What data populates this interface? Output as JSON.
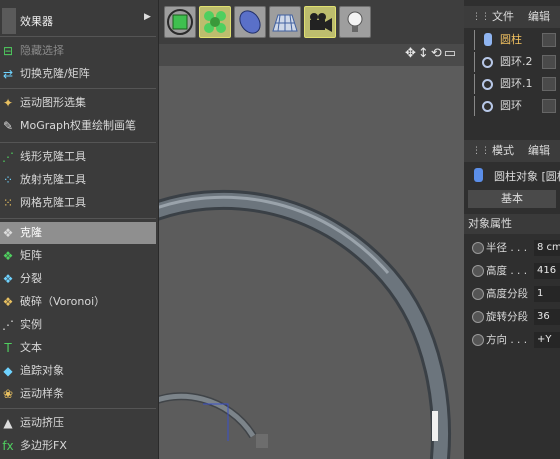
{
  "menu": {
    "title": "效果器",
    "items": [
      {
        "label": "隐藏选择",
        "icon": "⊟",
        "state": "disabled"
      },
      {
        "label": "切换克隆/矩阵",
        "icon": "⇄",
        "state": "normal"
      },
      {
        "label": "运动图形选集",
        "icon": "✦",
        "state": "normal"
      },
      {
        "label": "MoGraph权重绘制画笔",
        "icon": "✎",
        "state": "normal"
      },
      {
        "label": "线形克隆工具",
        "icon": "⋰",
        "state": "normal"
      },
      {
        "label": "放射克隆工具",
        "icon": "⁘",
        "state": "normal"
      },
      {
        "label": "网格克隆工具",
        "icon": "⁙",
        "state": "normal"
      },
      {
        "label": "克隆",
        "icon": "❖",
        "state": "selected"
      },
      {
        "label": "矩阵",
        "icon": "❖",
        "state": "normal"
      },
      {
        "label": "分裂",
        "icon": "❖",
        "state": "normal"
      },
      {
        "label": "破碎（Voronoi）",
        "icon": "❖",
        "state": "normal"
      },
      {
        "label": "实例",
        "icon": "⋰",
        "state": "normal"
      },
      {
        "label": "文本",
        "icon": "T",
        "state": "normal"
      },
      {
        "label": "追踪对象",
        "icon": "◆",
        "state": "normal"
      },
      {
        "label": "运动样条",
        "icon": "❀",
        "state": "normal"
      },
      {
        "label": "运动挤压",
        "icon": "▲",
        "state": "normal"
      },
      {
        "label": "多边形FX",
        "icon": "fx",
        "state": "normal"
      }
    ]
  },
  "objects_panel": {
    "tabs": [
      "文件",
      "编辑"
    ],
    "items": [
      {
        "label": "圆柱",
        "icon": "cylinder-icon",
        "selected": true
      },
      {
        "label": "圆环.2",
        "icon": "torus-icon",
        "selected": false
      },
      {
        "label": "圆环.1",
        "icon": "torus-icon",
        "selected": false
      },
      {
        "label": "圆环",
        "icon": "torus-icon",
        "selected": false
      }
    ]
  },
  "attributes_panel": {
    "tabs": [
      "模式",
      "编辑"
    ],
    "object_title": "圆柱对象 [圆柱",
    "basic_tab": "基本",
    "section": "对象属性",
    "fields": [
      {
        "label": "半径 . . .",
        "value": "8 cm"
      },
      {
        "label": "高度 . . .",
        "value": "416"
      },
      {
        "label": "高度分段",
        "value": "1"
      },
      {
        "label": "旋转分段",
        "value": "36"
      },
      {
        "label": "方向 . . .",
        "value": "+Y"
      }
    ]
  },
  "colors": {
    "accent": "#bdbd6e",
    "selected": "#8f8f8f",
    "panel": "#2f2f2f"
  }
}
